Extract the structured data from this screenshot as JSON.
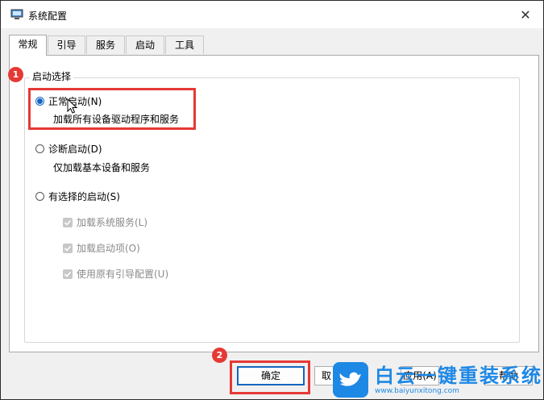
{
  "window": {
    "title": "系统配置",
    "close_glyph": "✕"
  },
  "tabs": [
    {
      "label": "常规",
      "active": true
    },
    {
      "label": "引导",
      "active": false
    },
    {
      "label": "服务",
      "active": false
    },
    {
      "label": "启动",
      "active": false
    },
    {
      "label": "工具",
      "active": false
    }
  ],
  "startup_selection": {
    "group_label": "启动选择",
    "normal": {
      "label": "正常启动(N)",
      "description": "加载所有设备驱动程序和服务",
      "checked": true
    },
    "diagnostic": {
      "label": "诊断启动(D)",
      "description": "仅加载基本设备和服务",
      "checked": false
    },
    "selective": {
      "label": "有选择的启动(S)",
      "checked": false,
      "options": [
        {
          "label": "加载系统服务(L)",
          "checked": true,
          "disabled": true
        },
        {
          "label": "加载启动项(O)",
          "checked": true,
          "disabled": true
        },
        {
          "label": "使用原有引导配置(U)",
          "checked": true,
          "disabled": true
        }
      ]
    }
  },
  "annotations": {
    "badge1": "1",
    "badge2": "2",
    "color": "#e53935"
  },
  "buttons": {
    "ok": "确定",
    "cancel": "取",
    "apply": "应用(A)",
    "help": "帮助"
  },
  "watermark": {
    "main": "白云一键重装系统",
    "sub": "www.baiyunxitong.com"
  },
  "colors": {
    "accent": "#1565c0",
    "annotation": "#e53935",
    "watermark": "#1e88e5"
  }
}
